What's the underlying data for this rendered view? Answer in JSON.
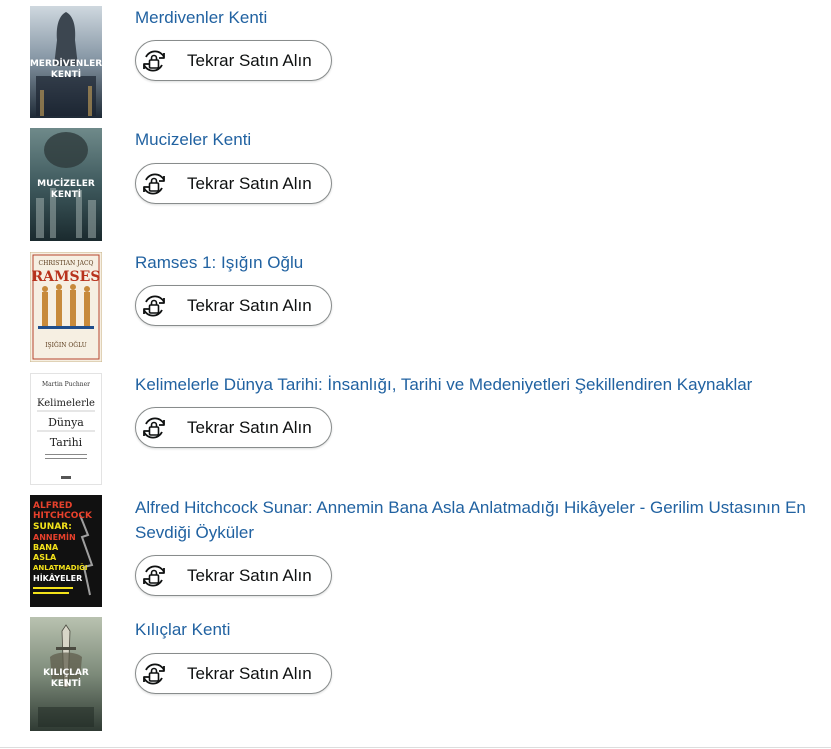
{
  "items": [
    {
      "title": "Merdivenler Kenti",
      "button": "Tekrar Satın Alın",
      "icon": "buy-again-icon",
      "cover": {
        "line1": "MERDİVENLER",
        "line2": "KENTİ",
        "bg": "#2b3a4a"
      }
    },
    {
      "title": "Mucizeler Kenti",
      "button": "Tekrar Satın Alın",
      "icon": "buy-again-icon",
      "cover": {
        "line1": "MUCİZELER",
        "line2": "KENTİ",
        "bg": "#27414a"
      }
    },
    {
      "title": "Ramses 1: Işığın Oğlu",
      "button": "Tekrar Satın Alın",
      "icon": "buy-again-icon",
      "cover": {
        "line1": "CHRISTIAN JACQ",
        "line2": "RAMSES",
        "line3": "IŞIĞIN OĞLU",
        "bg": "#f6efe2"
      }
    },
    {
      "title": "Kelimelerle Dünya Tarihi: İnsanlığı, Tarihi ve Medeniyetleri Şekillendiren Kaynaklar",
      "button": "Tekrar Satın Alın",
      "icon": "buy-again-icon",
      "cover": {
        "line0": "Martin Puchner",
        "line1": "Kelimelerle",
        "line2": "Dünya",
        "line3": "Tarihi",
        "bg": "#ffffff"
      }
    },
    {
      "title": "Alfred Hitchcock Sunar: Annemin Bana Asla Anlatmadığı Hikâyeler - Gerilim Ustasının En Sevdiği Öyküler",
      "button": "Tekrar Satın Alın",
      "icon": "buy-again-icon",
      "cover": {
        "line1": "ALFRED",
        "line2": "HITCHCOCK",
        "line3": "SUNAR:",
        "line4": "ANNEMİN",
        "line5": "BANA",
        "line6": "ASLA",
        "line7": "ANLATMADIĞI",
        "line8": "HİKÂYELER",
        "bg": "#111111"
      }
    },
    {
      "title": "Kılıçlar Kenti",
      "button": "Tekrar Satın Alın",
      "icon": "buy-again-icon",
      "cover": {
        "line1": "KILIÇLAR",
        "line2": "KENTİ",
        "bg": "#5b6a5e"
      }
    }
  ]
}
